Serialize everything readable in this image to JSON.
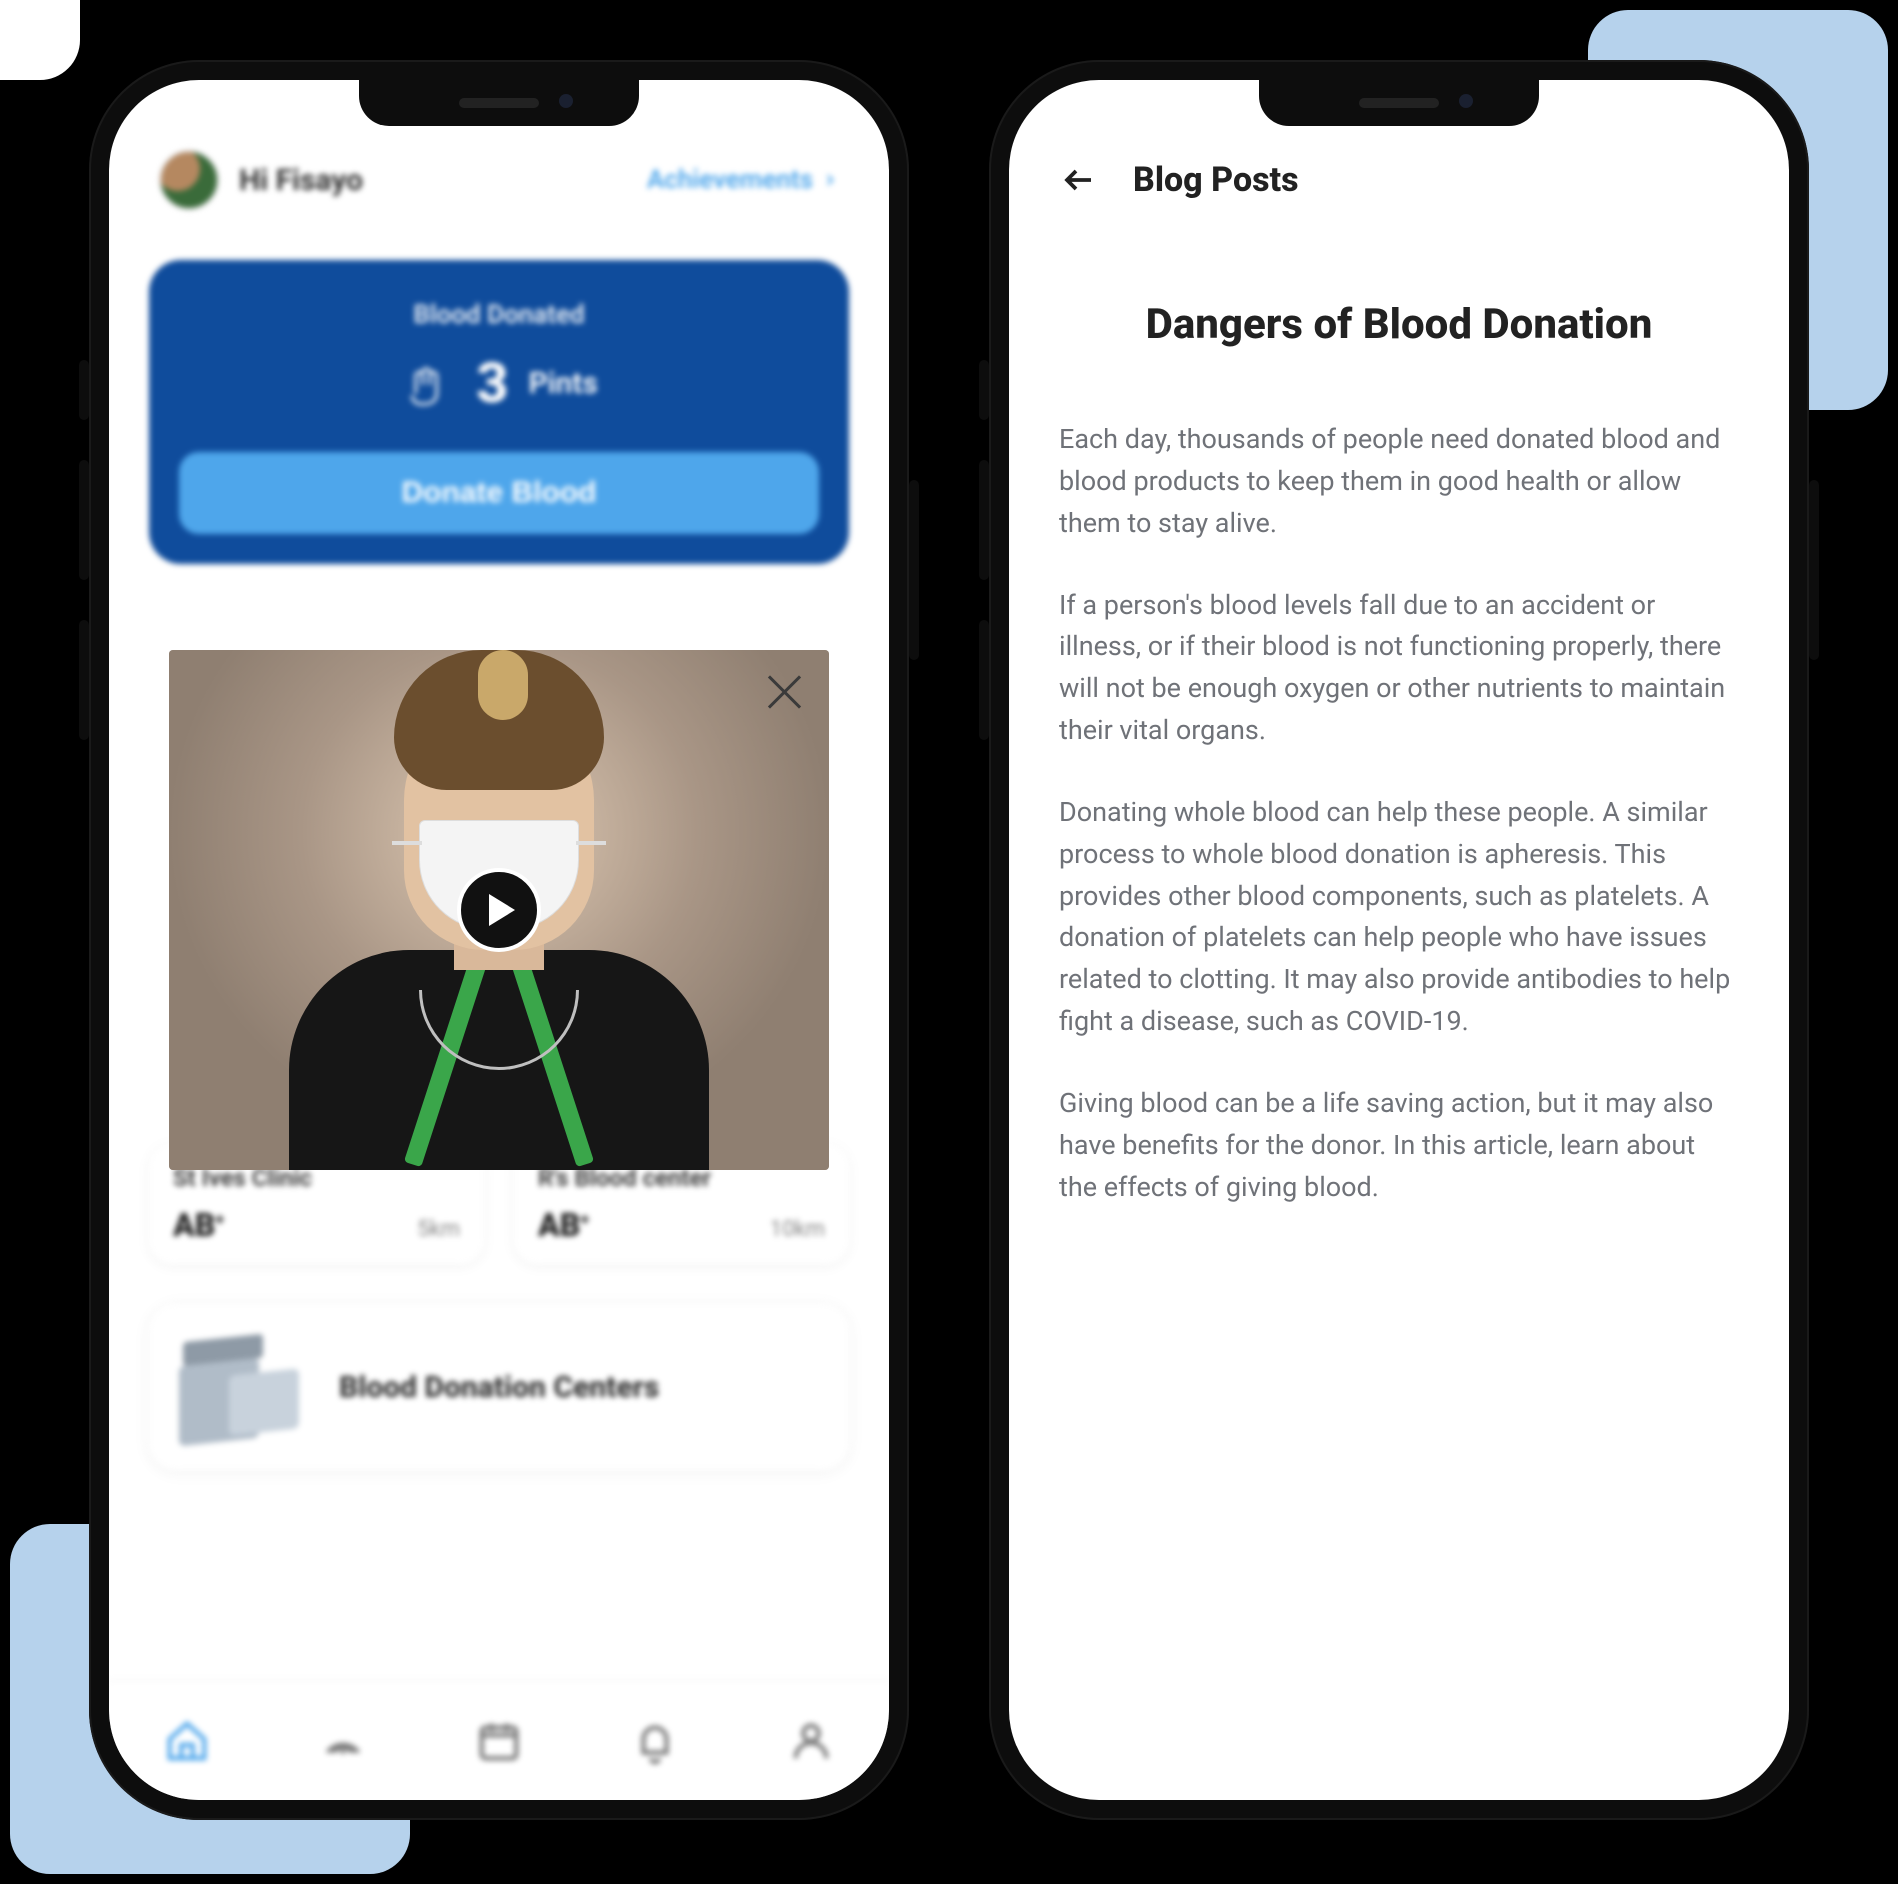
{
  "left": {
    "greeting": "Hi Fisayo",
    "achievements_link": "Achievements",
    "stat_card": {
      "title": "Blood Donated",
      "value": "3",
      "unit": "Pints",
      "cta": "Donate Blood"
    },
    "clinics": [
      {
        "name": "St Ives Clinic",
        "blood_type": "AB",
        "blood_sign": "+",
        "distance": "5km"
      },
      {
        "name": "R's Blood center",
        "blood_type": "AB",
        "blood_sign": "+",
        "distance": "10km"
      }
    ],
    "centers_card": "Blood Donation Centers",
    "tabs": [
      "home",
      "radar",
      "calendar",
      "bell",
      "profile"
    ]
  },
  "right": {
    "header": "Blog Posts",
    "article_title": "Dangers of Blood Donation",
    "paragraphs": [
      "Each day, thousands of people need donated blood and blood products to keep them in good health or allow them to stay alive.",
      "If a person's blood levels fall due to an accident or illness, or if their blood is not functioning properly, there will not be enough oxygen or other nutrients to maintain their vital organs.",
      "Donating whole blood can help these people.  A similar process to whole blood donation is apheresis. This provides other blood components, such as platelets. A donation of platelets can help people who have issues related to clotting. It may also provide antibodies to help fight a disease, such as COVID-19.",
      "Giving blood can be a life saving action, but it may also have benefits for the donor. In this article, learn about the effects of giving blood."
    ]
  }
}
